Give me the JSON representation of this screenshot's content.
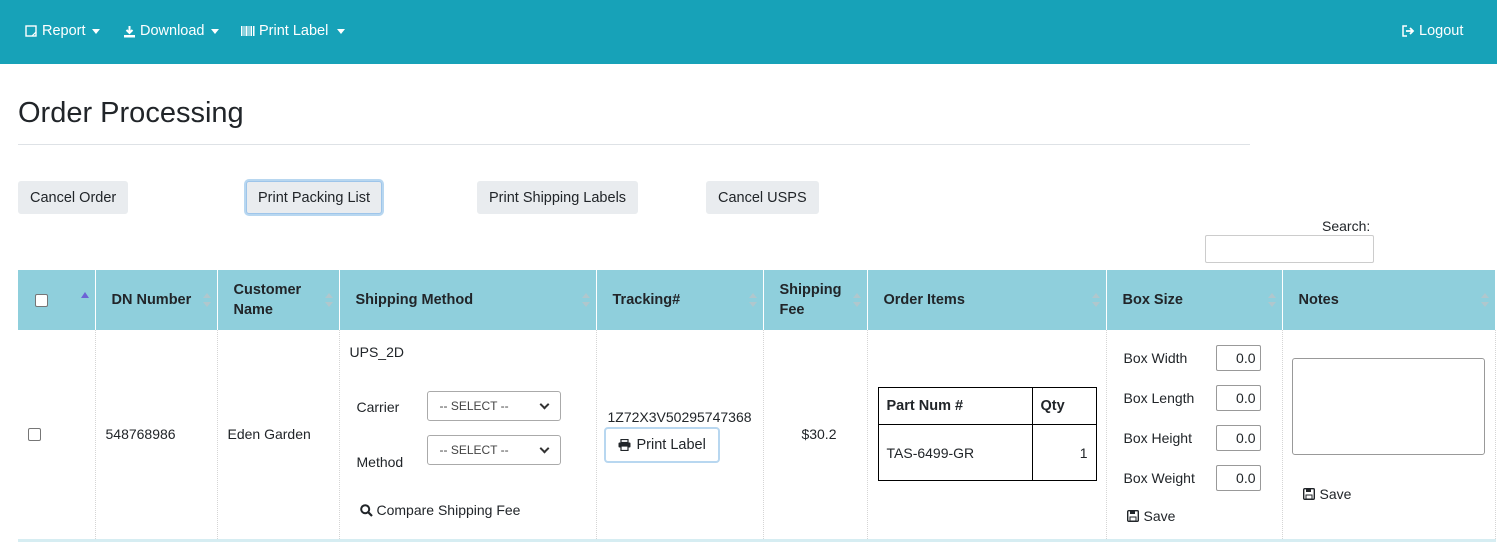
{
  "nav": {
    "report": "Report",
    "download": "Download",
    "print_label": "Print Label",
    "logout": "Logout"
  },
  "page_title": "Order Processing",
  "actions": {
    "cancel_order": "Cancel Order",
    "print_packing_list": "Print Packing List",
    "print_shipping_labels": "Print Shipping Labels",
    "cancel_usps": "Cancel USPS"
  },
  "search": {
    "label": "Search:",
    "value": ""
  },
  "table": {
    "headers": {
      "dn_number": "DN Number",
      "customer_name": "Customer Name",
      "shipping_method": "Shipping Method",
      "tracking": "Tracking#",
      "shipping_fee": "Shipping Fee",
      "order_items": "Order Items",
      "box_size": "Box Size",
      "notes": "Notes"
    },
    "row": {
      "dn_number": "548768986",
      "customer_name": "Eden Garden",
      "shipping_method": "UPS_2D",
      "carrier_label": "Carrier",
      "carrier_value": "-- SELECT --",
      "method_label": "Method",
      "method_value": "-- SELECT --",
      "compare_label": "Compare Shipping Fee",
      "tracking_number": "1Z72X3V50295747368",
      "print_label_btn": "Print Label",
      "shipping_fee": "$30.2",
      "items_headers": {
        "part": "Part Num #",
        "qty": "Qty"
      },
      "items": [
        {
          "part": "TAS-6499-GR",
          "qty": "1"
        }
      ],
      "box": {
        "width_label": "Box Width",
        "width": "0.0",
        "length_label": "Box Length",
        "length": "0.0",
        "height_label": "Box Height",
        "height": "0.0",
        "weight_label": "Box Weight",
        "weight": "0.0",
        "save": "Save"
      },
      "notes": {
        "value": "",
        "save": "Save"
      }
    }
  },
  "colors": {
    "navbar": "#17a2b8",
    "table_header": "#8fcfdc",
    "button_bg": "#e9ecef"
  }
}
